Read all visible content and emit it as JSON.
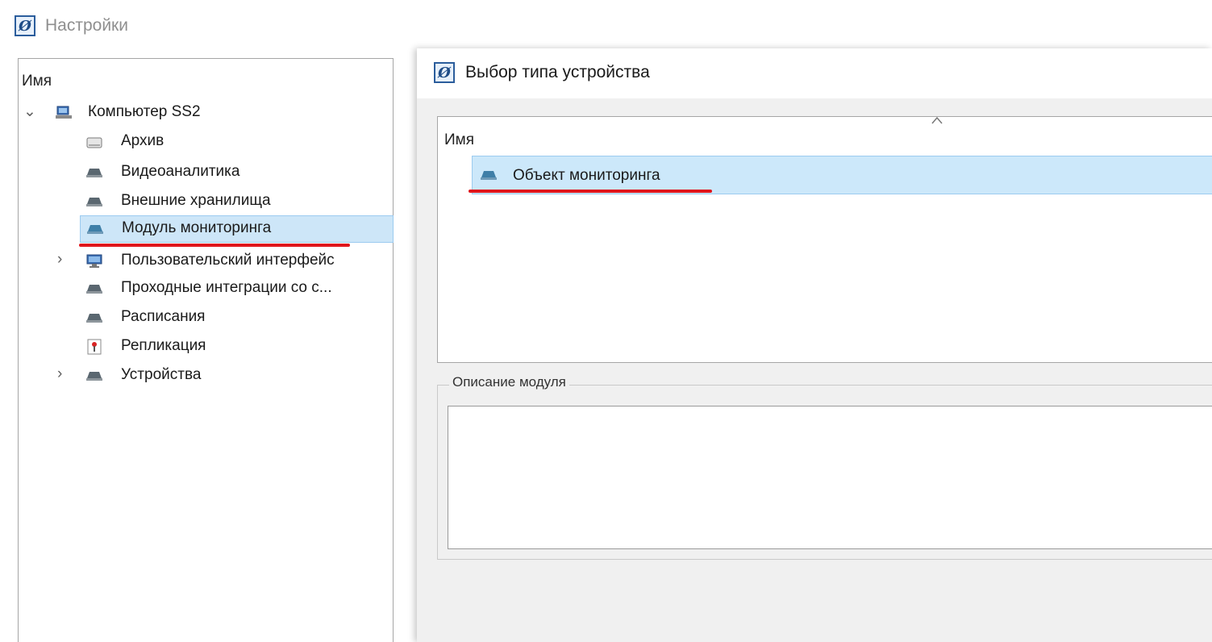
{
  "window": {
    "title": "Настройки"
  },
  "left_tree": {
    "column_header": "Имя",
    "root": {
      "label": "Компьютер SS2",
      "expanded": true,
      "icon": "computer-icon"
    },
    "items": [
      {
        "label": "Архив",
        "icon": "drive-icon",
        "has_children": false
      },
      {
        "label": "Видеоаналитика",
        "icon": "module-icon",
        "has_children": false
      },
      {
        "label": "Внешние хранилища",
        "icon": "module-icon",
        "has_children": false
      },
      {
        "label": "Модуль мониторинга",
        "icon": "module-icon",
        "has_children": false,
        "selected": true
      },
      {
        "label": "Пользовательский интерфейс",
        "icon": "monitor-icon",
        "has_children": true
      },
      {
        "label": "Проходные интеграции со с...",
        "icon": "module-icon",
        "has_children": false
      },
      {
        "label": "Расписания",
        "icon": "module-icon",
        "has_children": false
      },
      {
        "label": "Репликация",
        "icon": "replication-icon",
        "has_children": false
      },
      {
        "label": "Устройства",
        "icon": "module-icon",
        "has_children": true
      }
    ]
  },
  "device_type_panel": {
    "title": "Выбор типа устройства",
    "list_header": "Имя",
    "items": [
      {
        "label": "Объект мониторинга",
        "icon": "module-icon",
        "selected": true
      }
    ],
    "description_group_label": "Описание модуля",
    "description_text": ""
  },
  "colors": {
    "selection": "#cde6f8",
    "selection_border": "#9ccbf0",
    "annotation_underline": "#e0161c",
    "panel_background": "#f0f0f0"
  }
}
